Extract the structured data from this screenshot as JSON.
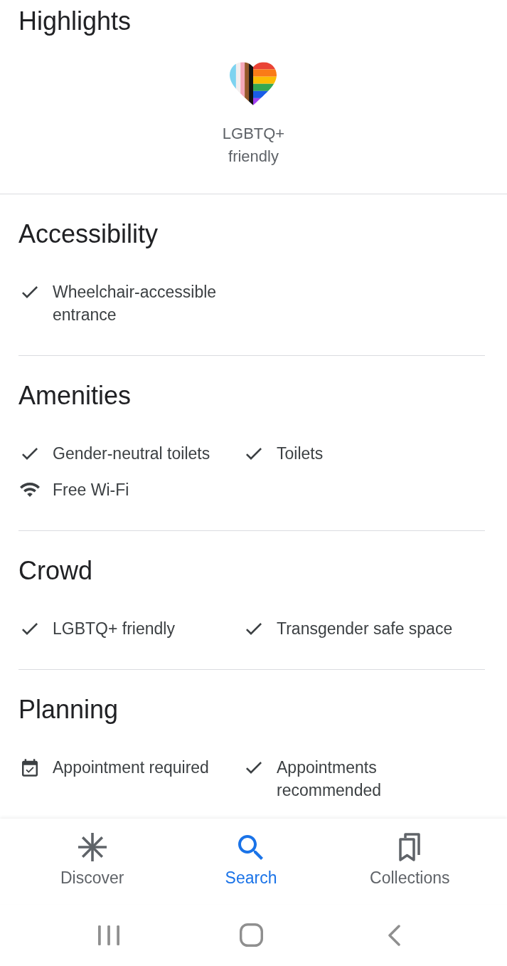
{
  "highlights": {
    "title": "Highlights",
    "items": [
      {
        "label": "LGBTQ+ friendly"
      }
    ]
  },
  "sections": [
    {
      "title": "Accessibility",
      "items": [
        {
          "kind": "check",
          "label": "Wheelchair-accessible entrance"
        }
      ]
    },
    {
      "title": "Amenities",
      "items": [
        {
          "kind": "check",
          "label": "Gender-neutral toilets"
        },
        {
          "kind": "check",
          "label": "Toilets"
        },
        {
          "kind": "wifi",
          "label": "Free Wi-Fi"
        }
      ]
    },
    {
      "title": "Crowd",
      "items": [
        {
          "kind": "check",
          "label": "LGBTQ+ friendly"
        },
        {
          "kind": "check",
          "label": "Transgender safe space"
        }
      ]
    },
    {
      "title": "Planning",
      "items": [
        {
          "kind": "calendar",
          "label": "Appointment required"
        },
        {
          "kind": "check",
          "label": "Appointments recommended"
        }
      ]
    }
  ],
  "bottom_nav": {
    "tabs": [
      {
        "kind": "discover",
        "label": "Discover",
        "selected": false
      },
      {
        "kind": "search",
        "label": "Search",
        "selected": true
      },
      {
        "kind": "collections",
        "label": "Collections",
        "selected": false
      }
    ]
  }
}
